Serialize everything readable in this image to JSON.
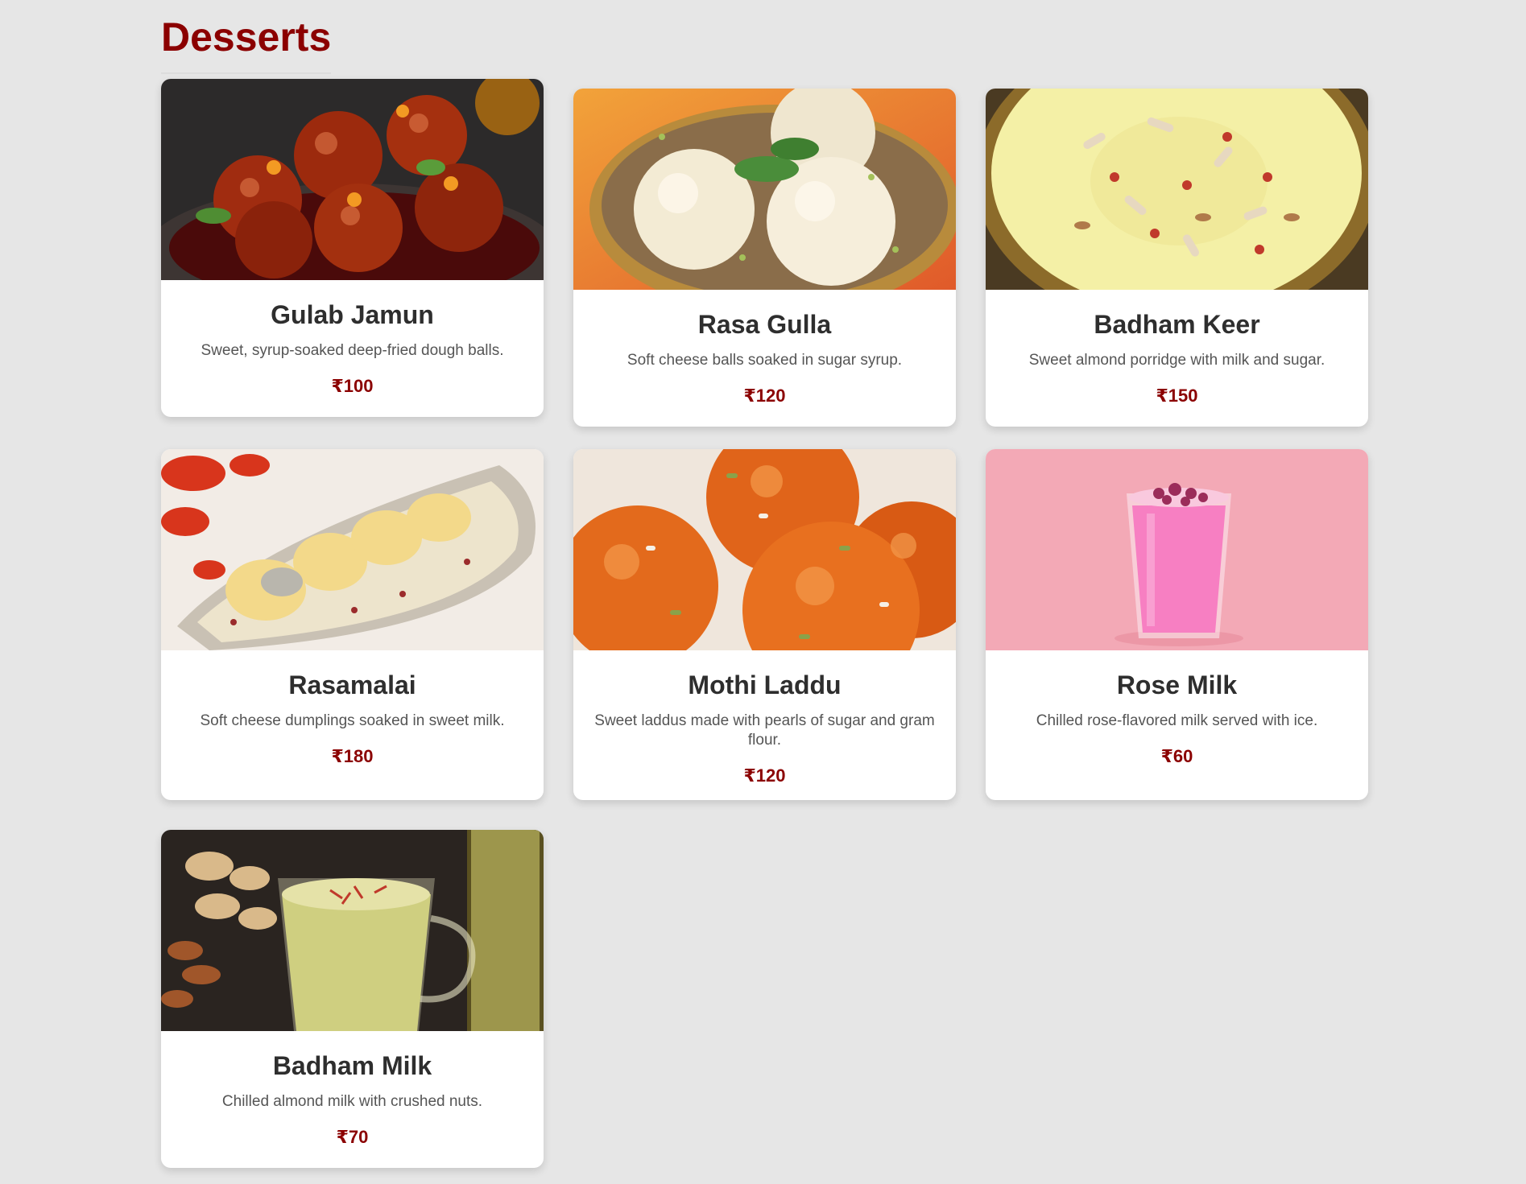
{
  "section": {
    "title": "Desserts"
  },
  "items": [
    {
      "name": "Gulab Jamun",
      "description": "Sweet, syrup-soaked deep-fried dough balls.",
      "price": "₹100",
      "image_icon": "gulab-jamun-photo"
    },
    {
      "name": "Rasa Gulla",
      "description": "Soft cheese balls soaked in sugar syrup.",
      "price": "₹120",
      "image_icon": "rasa-gulla-photo"
    },
    {
      "name": "Badham Keer",
      "description": "Sweet almond porridge with milk and sugar.",
      "price": "₹150",
      "image_icon": "badham-keer-photo"
    },
    {
      "name": "Rasamalai",
      "description": "Soft cheese dumplings soaked in sweet milk.",
      "price": "₹180",
      "image_icon": "rasamalai-photo"
    },
    {
      "name": "Mothi Laddu",
      "description": "Sweet laddus made with pearls of sugar and gram flour.",
      "price": "₹120",
      "image_icon": "mothi-laddu-photo"
    },
    {
      "name": "Rose Milk",
      "description": "Chilled rose-flavored milk served with ice.",
      "price": "₹60",
      "image_icon": "rose-milk-photo"
    },
    {
      "name": "Badham Milk",
      "description": "Chilled almond milk with crushed nuts.",
      "price": "₹70",
      "image_icon": "badham-milk-photo"
    }
  ],
  "colors": {
    "accent": "#8b0000",
    "background": "#e6e6e6",
    "card": "#ffffff",
    "heading": "#2e2e2e",
    "text": "#555555"
  }
}
